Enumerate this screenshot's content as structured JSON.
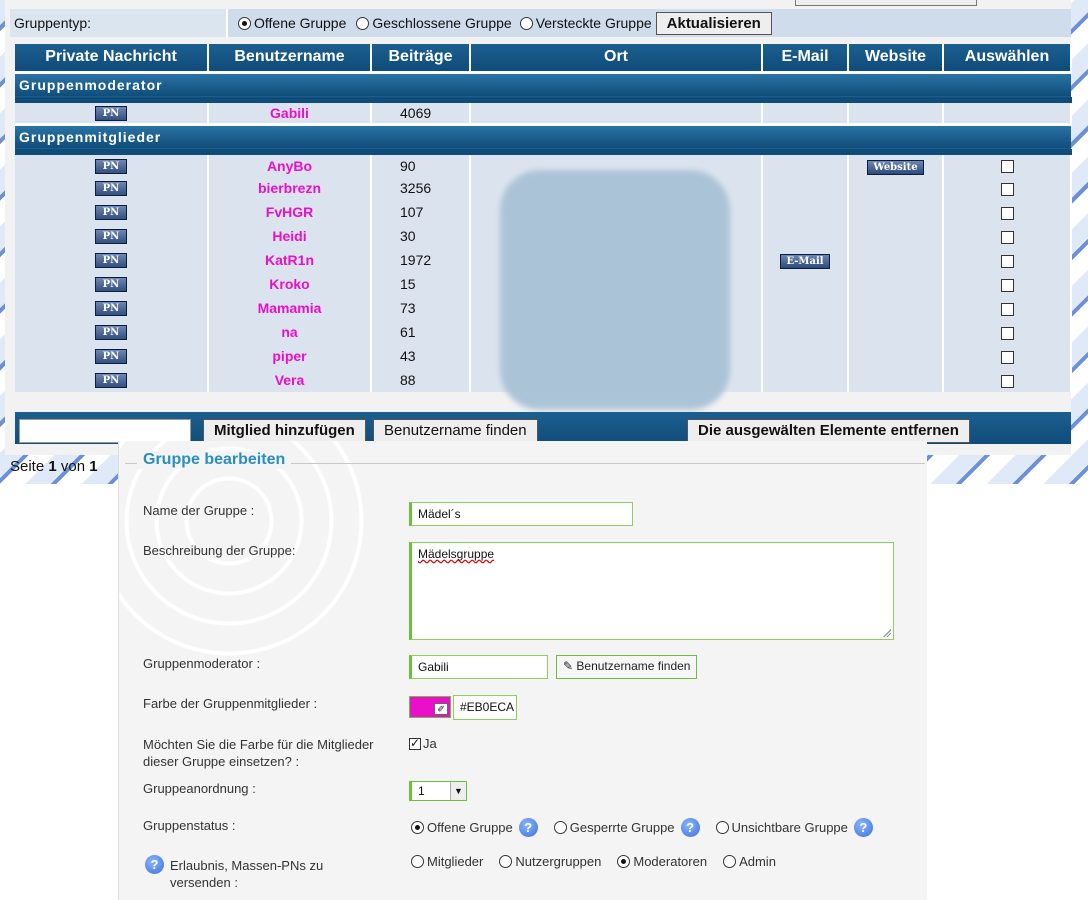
{
  "group_type": {
    "label": "Gruppentyp:",
    "options": [
      "Offene Gruppe",
      "Geschlossene Gruppe",
      "Versteckte Gruppe"
    ],
    "update_button": "Aktualisieren"
  },
  "table": {
    "headers": [
      "Private Nachricht",
      "Benutzername",
      "Beiträge",
      "Ort",
      "E-Mail",
      "Website",
      "Auswählen"
    ],
    "moderator_section": "Gruppenmoderator",
    "members_section": "Gruppenmitglieder",
    "pn_label": "PN",
    "website_label": "Website",
    "email_label": "E-Mail",
    "moderator": {
      "name": "Gabili",
      "posts": "4069"
    },
    "members": [
      {
        "name": "AnyBo",
        "posts": "90"
      },
      {
        "name": "bierbrezn",
        "posts": "3256"
      },
      {
        "name": "FvHGR",
        "posts": "107"
      },
      {
        "name": "Heidi",
        "posts": "30"
      },
      {
        "name": "KatR1n",
        "posts": "1972"
      },
      {
        "name": "Kroko",
        "posts": "15"
      },
      {
        "name": "Mamamia",
        "posts": "73"
      },
      {
        "name": "na",
        "posts": "61"
      },
      {
        "name": "piper",
        "posts": "43"
      },
      {
        "name": "Vera",
        "posts": "88"
      }
    ]
  },
  "footer": {
    "add_member": "Mitglied hinzufügen",
    "find_user": "Benutzername finden",
    "remove_selected": "Die ausgewälten Elemente entfernen",
    "page_prefix": "Seite",
    "page_current": "1",
    "page_sep": "von",
    "page_total": "1"
  },
  "edit": {
    "legend": "Gruppe bearbeiten",
    "name_label": "Name der Gruppe :",
    "name_value": "Mädel´s",
    "desc_label": "Beschreibung der Gruppe:",
    "desc_value": "Mädelsgruppe",
    "mod_label": "Gruppenmoderator :",
    "mod_value": "Gabili",
    "find_user": "Benutzername finden",
    "color_label": "Farbe der Gruppenmitglieder :",
    "color_value": "#EB0ECA",
    "use_color_label": "Möchten Sie die Farbe für die Mitglieder dieser Gruppe einsetzen? :",
    "use_color_yes": "Ja",
    "order_label": "Gruppeanordnung :",
    "order_value": "1",
    "status_label": "Gruppenstatus :",
    "status_options": [
      "Offene Gruppe",
      "Gesperrte Gruppe",
      "Unsichtbare Gruppe"
    ],
    "mass_pm_label": "Erlaubnis, Massen-PNs zu versenden :",
    "mass_pm_options": [
      "Mitglieder",
      "Nutzergruppen",
      "Moderatoren",
      "Admin"
    ]
  },
  "colors": {
    "member_color": "#EB0ECA",
    "header_blue": "#0f4c7a",
    "accent_green": "#6cbf3a"
  }
}
